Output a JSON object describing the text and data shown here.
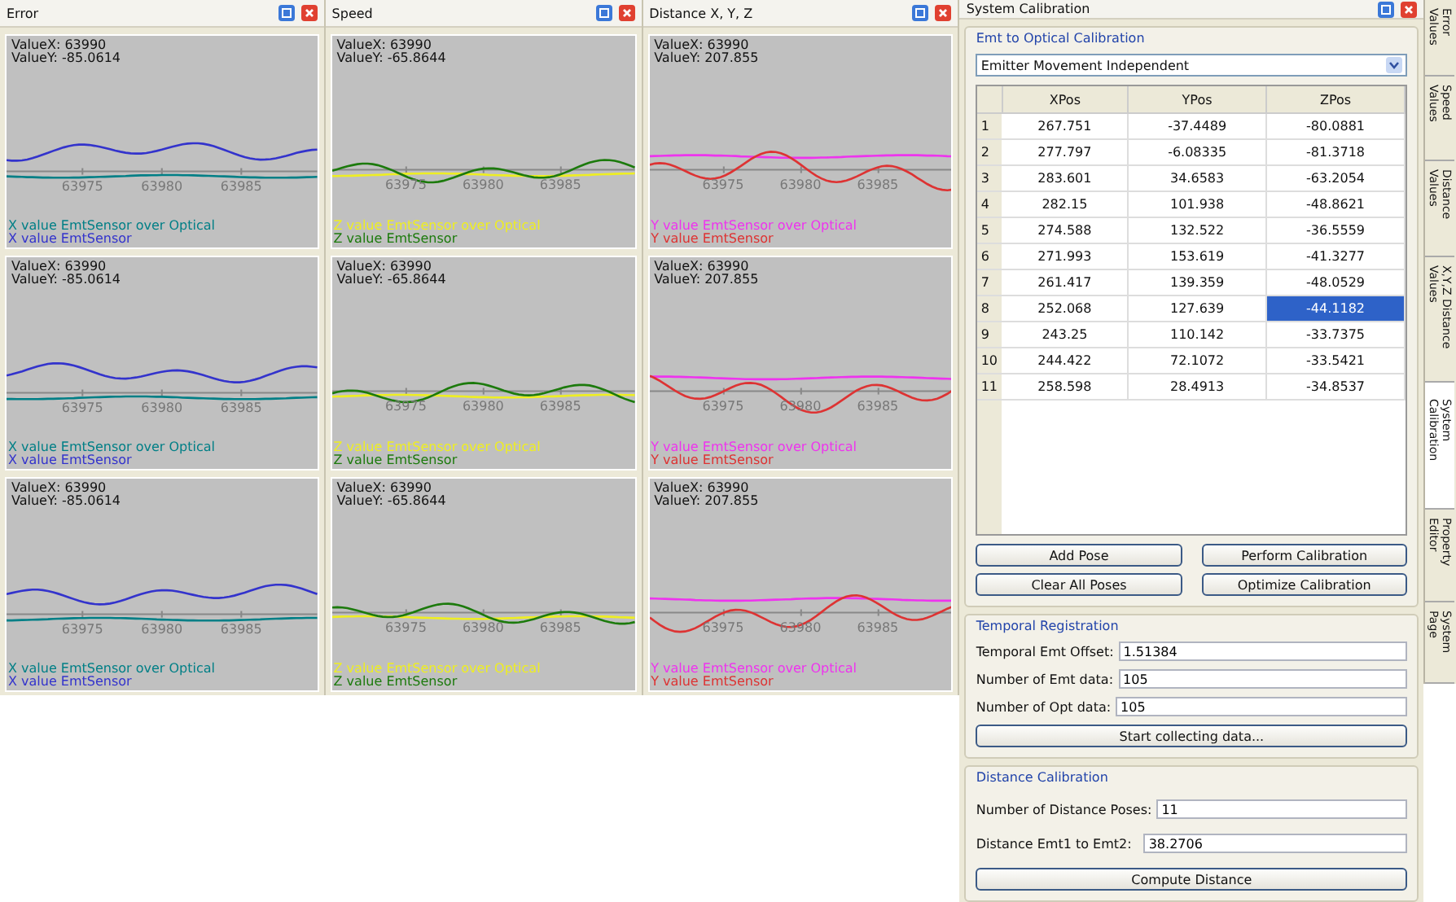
{
  "plot_panels": [
    {
      "title": "Error",
      "plots": [
        {
          "value_x": "ValueX: 63990",
          "value_y": "ValueY: -85.0614",
          "x_ticks": [
            "63975",
            "63980",
            "63985"
          ],
          "legend": [
            {
              "text": "X value EmtSensor over Optical",
              "color": "#007f86",
              "kind": "flat"
            },
            {
              "text": "X value EmtSensor",
              "color": "#3333cc",
              "kind": "wavy"
            }
          ]
        },
        {
          "value_x": "ValueX: 63990",
          "value_y": "ValueY: -85.0614",
          "x_ticks": [
            "63975",
            "63980",
            "63985"
          ],
          "legend": [
            {
              "text": "X value EmtSensor over Optical",
              "color": "#007f86",
              "kind": "flat"
            },
            {
              "text": "X value EmtSensor",
              "color": "#3333cc",
              "kind": "wavy"
            }
          ]
        },
        {
          "value_x": "ValueX: 63990",
          "value_y": "ValueY: -85.0614",
          "x_ticks": [
            "63975",
            "63980",
            "63985"
          ],
          "legend": [
            {
              "text": "X value EmtSensor over Optical",
              "color": "#007f86",
              "kind": "flat"
            },
            {
              "text": "X value EmtSensor",
              "color": "#3333cc",
              "kind": "wavy"
            }
          ]
        }
      ]
    },
    {
      "title": "Speed",
      "plots": [
        {
          "value_x": "ValueX: 63990",
          "value_y": "ValueY: -65.8644",
          "x_ticks": [
            "63975",
            "63980",
            "63985"
          ],
          "legend": [
            {
              "text": "Z value EmtSensor over Optical",
              "color": "#eeee22",
              "kind": "flat"
            },
            {
              "text": "Z value EmtSensor",
              "color": "#1c7a0c",
              "kind": "wavy"
            }
          ]
        },
        {
          "value_x": "ValueX: 63990",
          "value_y": "ValueY: -65.8644",
          "x_ticks": [
            "63975",
            "63980",
            "63985"
          ],
          "legend": [
            {
              "text": "Z value EmtSensor over Optical",
              "color": "#eeee22",
              "kind": "flat"
            },
            {
              "text": "Z value EmtSensor",
              "color": "#1c7a0c",
              "kind": "wavy"
            }
          ]
        },
        {
          "value_x": "ValueX: 63990",
          "value_y": "ValueY: -65.8644",
          "x_ticks": [
            "63975",
            "63980",
            "63985"
          ],
          "legend": [
            {
              "text": "Z value EmtSensor over Optical",
              "color": "#eeee22",
              "kind": "flat"
            },
            {
              "text": "Z value EmtSensor",
              "color": "#1c7a0c",
              "kind": "wavy"
            }
          ]
        }
      ]
    },
    {
      "title": "Distance X, Y, Z",
      "plots": [
        {
          "value_x": "ValueX: 63990",
          "value_y": "ValueY: 207.855",
          "x_ticks": [
            "63975",
            "63980",
            "63985"
          ],
          "legend": [
            {
              "text": "Y value EmtSensor over Optical",
              "color": "#ee33ee",
              "kind": "flat"
            },
            {
              "text": "Y value EmtSensor",
              "color": "#dd3333",
              "kind": "wavy"
            }
          ]
        },
        {
          "value_x": "ValueX: 63990",
          "value_y": "ValueY: 207.855",
          "x_ticks": [
            "63975",
            "63980",
            "63985"
          ],
          "legend": [
            {
              "text": "Y value EmtSensor over Optical",
              "color": "#ee33ee",
              "kind": "flat"
            },
            {
              "text": "Y value EmtSensor",
              "color": "#dd3333",
              "kind": "wavy"
            }
          ]
        },
        {
          "value_x": "ValueX: 63990",
          "value_y": "ValueY: 207.855",
          "x_ticks": [
            "63975",
            "63980",
            "63985"
          ],
          "legend": [
            {
              "text": "Y value EmtSensor over Optical",
              "color": "#ee33ee",
              "kind": "flat"
            },
            {
              "text": "Y value EmtSensor",
              "color": "#dd3333",
              "kind": "wavy"
            }
          ]
        }
      ]
    }
  ],
  "calibration_panel": {
    "title": "System Calibration",
    "emt_group": {
      "title": "Emt to Optical Calibration",
      "dropdown": "Emitter Movement Independent",
      "columns": [
        "XPos",
        "YPos",
        "ZPos"
      ],
      "rows": [
        {
          "index": "1",
          "cells": [
            {
              "text": "267.751",
              "selected": false
            },
            {
              "text": "-37.4489",
              "selected": false
            },
            {
              "text": "-80.0881",
              "selected": false
            }
          ]
        },
        {
          "index": "2",
          "cells": [
            {
              "text": "277.797",
              "selected": false
            },
            {
              "text": "-6.08335",
              "selected": false
            },
            {
              "text": "-81.3718",
              "selected": false
            }
          ]
        },
        {
          "index": "3",
          "cells": [
            {
              "text": "283.601",
              "selected": false
            },
            {
              "text": "34.6583",
              "selected": false
            },
            {
              "text": "-63.2054",
              "selected": false
            }
          ]
        },
        {
          "index": "4",
          "cells": [
            {
              "text": "282.15",
              "selected": false
            },
            {
              "text": "101.938",
              "selected": false
            },
            {
              "text": "-48.8621",
              "selected": false
            }
          ]
        },
        {
          "index": "5",
          "cells": [
            {
              "text": "274.588",
              "selected": false
            },
            {
              "text": "132.522",
              "selected": false
            },
            {
              "text": "-36.5559",
              "selected": false
            }
          ]
        },
        {
          "index": "6",
          "cells": [
            {
              "text": "271.993",
              "selected": false
            },
            {
              "text": "153.619",
              "selected": false
            },
            {
              "text": "-41.3277",
              "selected": false
            }
          ]
        },
        {
          "index": "7",
          "cells": [
            {
              "text": "261.417",
              "selected": false
            },
            {
              "text": "139.359",
              "selected": false
            },
            {
              "text": "-48.0529",
              "selected": false
            }
          ]
        },
        {
          "index": "8",
          "cells": [
            {
              "text": "252.068",
              "selected": false
            },
            {
              "text": "127.639",
              "selected": false
            },
            {
              "text": "-44.1182",
              "selected": true
            }
          ]
        },
        {
          "index": "9",
          "cells": [
            {
              "text": "243.25",
              "selected": false
            },
            {
              "text": "110.142",
              "selected": false
            },
            {
              "text": "-33.7375",
              "selected": false
            }
          ]
        },
        {
          "index": "10",
          "cells": [
            {
              "text": "244.422",
              "selected": false
            },
            {
              "text": "72.1072",
              "selected": false
            },
            {
              "text": "-33.5421",
              "selected": false
            }
          ]
        },
        {
          "index": "11",
          "cells": [
            {
              "text": "258.598",
              "selected": false
            },
            {
              "text": "28.4913",
              "selected": false
            },
            {
              "text": "-34.8537",
              "selected": false
            }
          ]
        }
      ],
      "buttons": [
        "Add Pose",
        "Perform Calibration",
        "Clear All Poses",
        "Optimize Calibration"
      ]
    },
    "temporal_group": {
      "title": "Temporal Registration",
      "fields": [
        {
          "label": "Temporal Emt Offset:",
          "value": "1.51384"
        },
        {
          "label": "Number of Emt data:",
          "value": "105"
        },
        {
          "label": "Number of Opt data:",
          "value": "105"
        }
      ],
      "button": "Start collecting data..."
    },
    "distance_group": {
      "title": "Distance Calibration",
      "fields": [
        {
          "label": "Number of Distance Poses:",
          "value": "11"
        },
        {
          "label": "Distance Emt1 to Emt2:",
          "value": "38.2706"
        }
      ],
      "button": "Compute Distance"
    }
  },
  "side_tabs": [
    {
      "label": "Error Values",
      "selected": false
    },
    {
      "label": "Speed Values",
      "selected": false
    },
    {
      "label": "Distance Values",
      "selected": false
    },
    {
      "label": "X,Y,Z Distance Values",
      "selected": false
    },
    {
      "label": "System Calibration",
      "selected": true
    },
    {
      "label": "Property Editor",
      "selected": false
    },
    {
      "label": "System Page",
      "selected": false
    }
  ]
}
